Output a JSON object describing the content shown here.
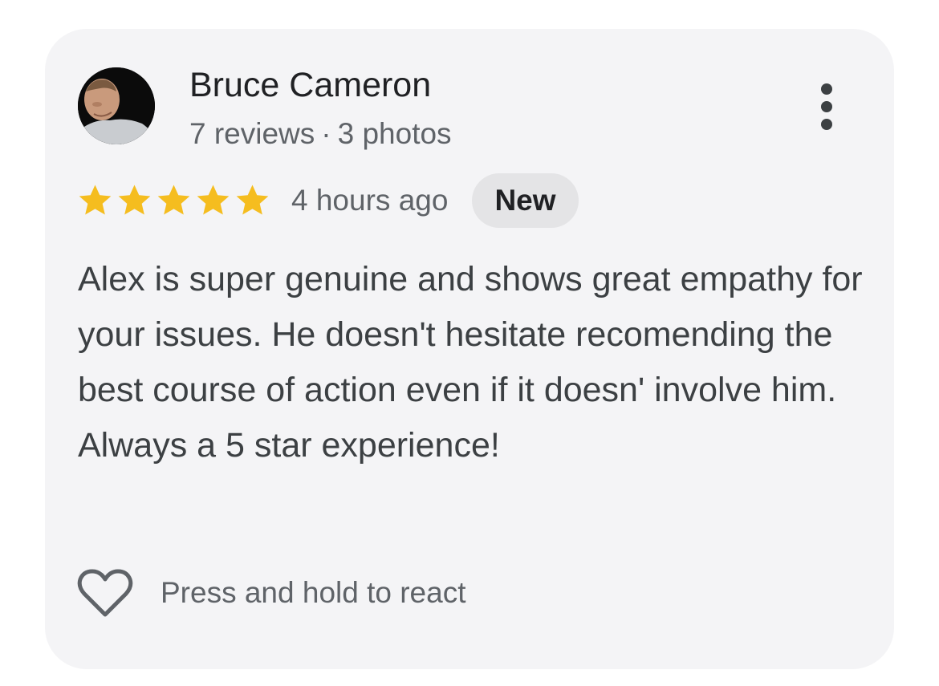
{
  "review": {
    "reviewer": {
      "name": "Bruce Cameron",
      "reviews_count": "7 reviews",
      "separator": "·",
      "photos_count": "3 photos",
      "avatar_icon": "profile-photo"
    },
    "rating": {
      "stars": 5,
      "max_stars": 5,
      "star_color": "#f5bd1f",
      "time_ago": "4 hours ago",
      "badge": "New"
    },
    "text": "Alex is super genuine and shows great empathy for your issues. He doesn't hesitate recomending the best course of action even if it doesn' involve him. Always a 5 star experience!",
    "reaction": {
      "icon": "heart-outline-icon",
      "label": "Press and hold to react"
    },
    "menu_icon": "more-vert-icon"
  },
  "colors": {
    "card_background": "#f4f4f6",
    "badge_background": "#e4e4e6",
    "primary_text": "#202124",
    "secondary_text": "#5f6368"
  }
}
